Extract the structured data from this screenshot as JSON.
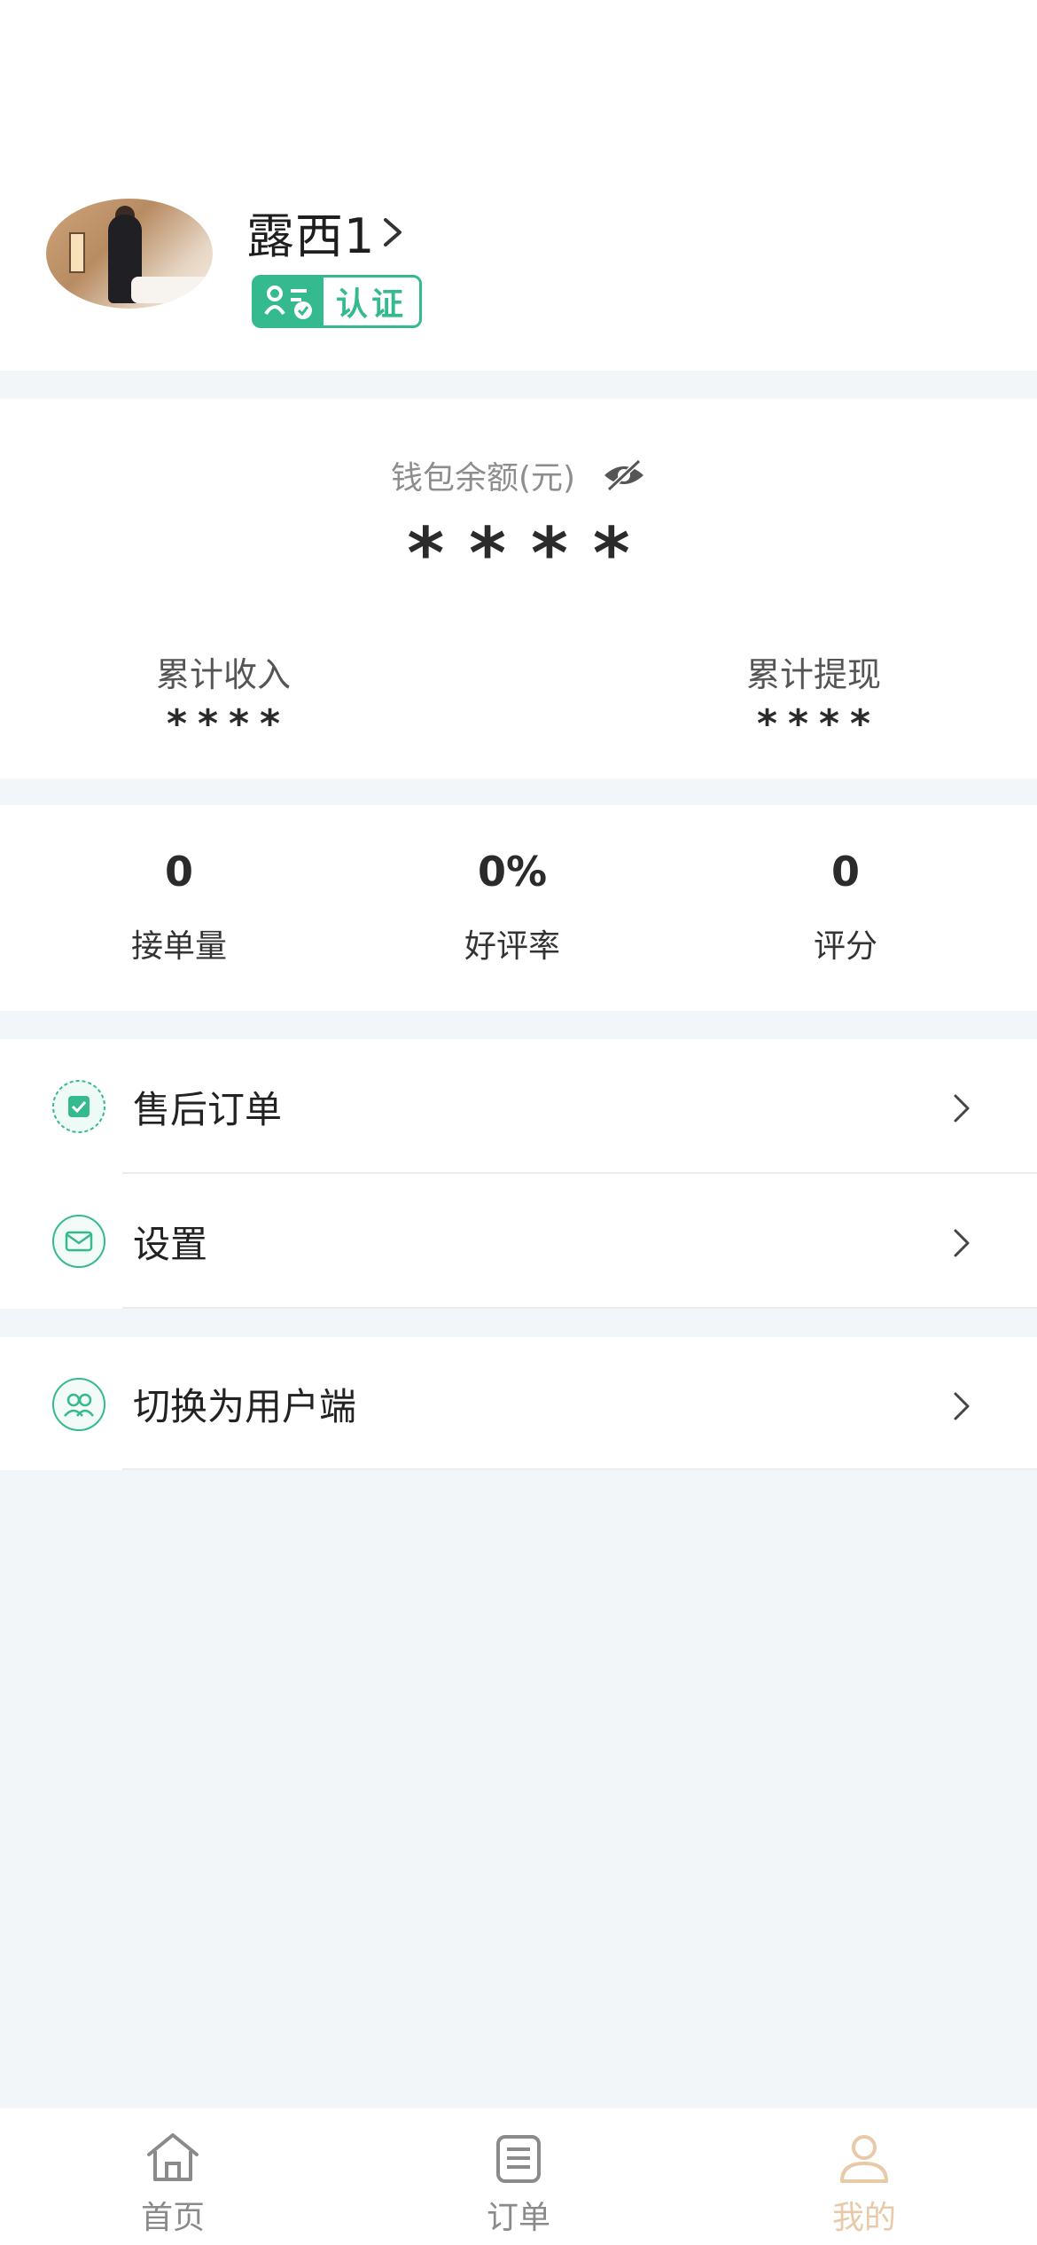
{
  "profile": {
    "name": "露西1",
    "badge_label": "认证"
  },
  "wallet": {
    "title": "钱包余额(元)",
    "balance": "****",
    "income_label": "累计收入",
    "income_value": "****",
    "withdraw_label": "累计提现",
    "withdraw_value": "****"
  },
  "stats": [
    {
      "value": "0",
      "label": "接单量"
    },
    {
      "value": "0%",
      "label": "好评率"
    },
    {
      "value": "0",
      "label": "评分"
    }
  ],
  "menu": {
    "after_sales": "售后订单",
    "settings": "设置",
    "switch_user": "切换为用户端"
  },
  "tabbar": {
    "home": "首页",
    "orders": "订单",
    "mine": "我的",
    "active_color": "#e8c9a8",
    "inactive_color": "#8a8a8a"
  },
  "colors": {
    "accent_green": "#35b98e"
  }
}
